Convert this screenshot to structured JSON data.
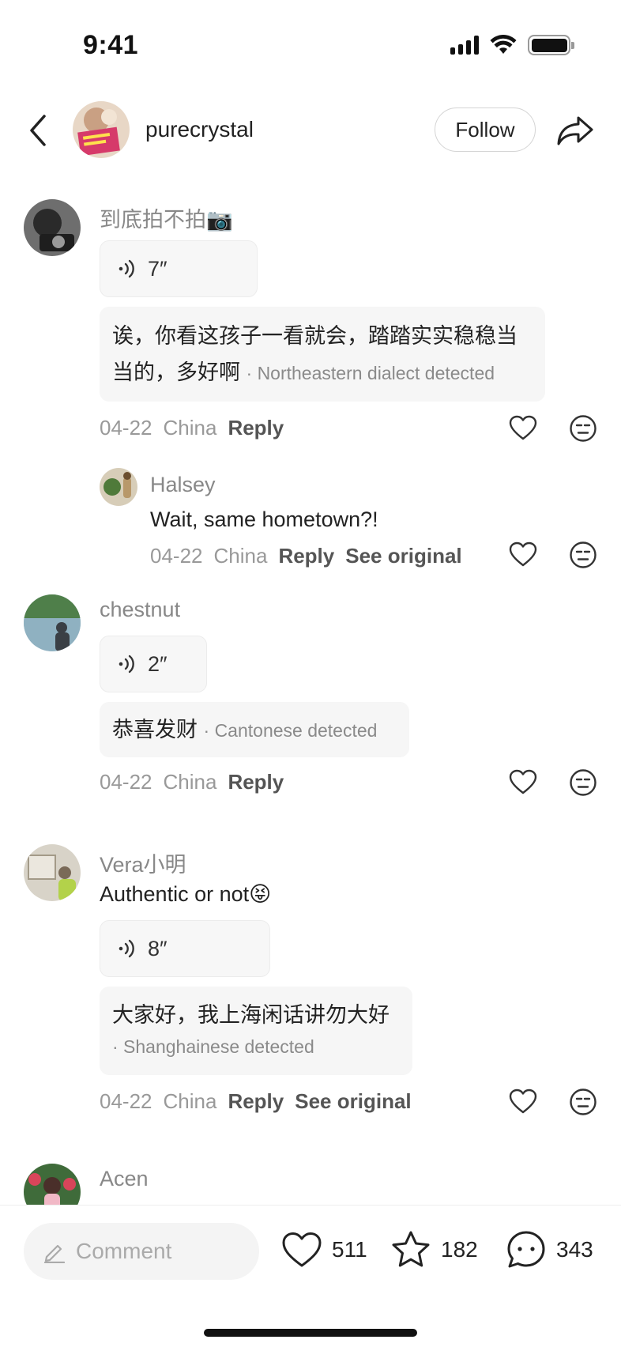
{
  "status_bar": {
    "time": "9:41"
  },
  "header": {
    "username": "purecrystal",
    "follow_label": "Follow"
  },
  "comments": [
    {
      "author": "到底拍不拍📷",
      "voice_duration": "7″",
      "transcript_line1": "诶，你看这孩子一看就会，踏踏实实稳稳当",
      "transcript_line2": "当的，多好啊",
      "dialect_tag": "· Northeastern dialect detected",
      "date": "04-22",
      "location": "China",
      "reply_label": "Reply",
      "reply": {
        "author": "Halsey",
        "text": "Wait, same hometown?!",
        "date": "04-22",
        "location": "China",
        "reply_label": "Reply",
        "see_original_label": "See original"
      }
    },
    {
      "author": "chestnut",
      "voice_duration": "2″",
      "transcript_line1": "恭喜发财",
      "dialect_tag": "· Cantonese detected",
      "date": "04-22",
      "location": "China",
      "reply_label": "Reply"
    },
    {
      "author": "Vera小明",
      "text": "Authentic or not😝",
      "voice_duration": "8″",
      "transcript_line1": "大家好，我上海闲话讲勿大好",
      "dialect_tag": "· Shanghainese detected",
      "date": "04-22",
      "location": "China",
      "reply_label": "Reply",
      "see_original_label": "See original"
    },
    {
      "author": "Acen"
    }
  ],
  "bottom_bar": {
    "comment_placeholder": "Comment",
    "likes": "511",
    "favorites": "182",
    "comments": "343"
  }
}
